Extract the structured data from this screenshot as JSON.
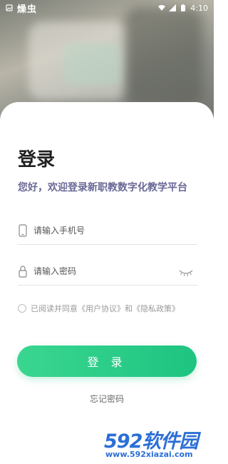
{
  "status_bar": {
    "app_name": "燥虫",
    "time": "4:10"
  },
  "login": {
    "title": "登录",
    "subtitle": "您好，欢迎登录新职教数字化教学平台",
    "phone_placeholder": "请输入手机号",
    "password_placeholder": "请输入密码",
    "agreement_text": "已阅读并同意《用户协议》和《隐私政策》",
    "login_button": "登 录",
    "forgot_password": "忘记密码"
  },
  "watermark": {
    "brand": "592软件园",
    "url": "www.592xiazai.com"
  },
  "colors": {
    "accent": "#1ec481",
    "subtitle": "#6a6996",
    "watermark": "#2b6fd6"
  }
}
